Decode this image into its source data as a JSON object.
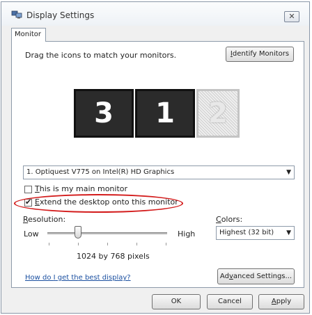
{
  "window": {
    "title": "Display Settings",
    "close_label": "✕"
  },
  "tab": {
    "label": "Monitor"
  },
  "instructions": "Drag the icons to match your monitors.",
  "identify_button": {
    "prefix": "",
    "underline": "I",
    "suffix": "dentify Monitors"
  },
  "monitors": {
    "m3": "3",
    "m1": "1",
    "m2": "2"
  },
  "monitor_select": {
    "value": "1. Optiquest V775 on Intel(R) HD Graphics"
  },
  "main_monitor": {
    "label_u": "T",
    "label_rest": "his is my main monitor",
    "checked": false
  },
  "extend_desktop": {
    "label_u": "E",
    "label_rest": "xtend the desktop onto this monitor",
    "checked": true
  },
  "resolution": {
    "label_u": "R",
    "label_rest": "esolution:",
    "low": "Low",
    "high": "High",
    "value_text": "1024 by 768 pixels",
    "slider_position_fraction": 0.27
  },
  "colors": {
    "label_u": "C",
    "label_rest": "olors:",
    "value": "Highest (32 bit)"
  },
  "help_link": {
    "prefix": "How do ",
    "underline": "I",
    "suffix": " get the best display?"
  },
  "advanced_button": {
    "prefix": "Ad",
    "underline": "v",
    "suffix": "anced Settings..."
  },
  "footer": {
    "ok": "OK",
    "cancel": "Cancel",
    "apply": {
      "prefix": "",
      "underline": "A",
      "suffix": "pply"
    }
  },
  "accent_colors": {
    "annotation_oval": "#d31b1b",
    "link": "#1a4fa0"
  }
}
